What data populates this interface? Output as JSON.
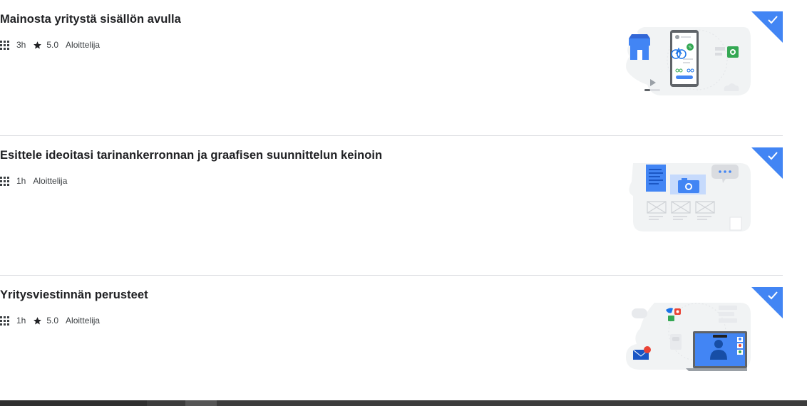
{
  "courses": [
    {
      "title": "Mainosta yritystä sisällön avulla",
      "duration": "3h",
      "rating": "5.0",
      "level": "Aloittelija",
      "completed": true,
      "illustration": "store-phone-illustration"
    },
    {
      "title": "Esittele ideoitasi tarinankerronnan ja graafisen suunnittelun keinoin",
      "duration": "1h",
      "rating": null,
      "level": "Aloittelija",
      "completed": true,
      "illustration": "document-camera-illustration"
    },
    {
      "title": "Yritysviestinnän perusteet",
      "duration": "1h",
      "rating": "5.0",
      "level": "Aloittelija",
      "completed": true,
      "illustration": "laptop-video-call-illustration"
    }
  ],
  "colors": {
    "accent": "#3367d6",
    "badge": "#4285f4",
    "divider": "#dadce0",
    "taskbar": "#3c3c3c"
  },
  "icons": {
    "modules": "grid-icon",
    "rating": "star-icon",
    "completed": "checkmark-icon"
  }
}
